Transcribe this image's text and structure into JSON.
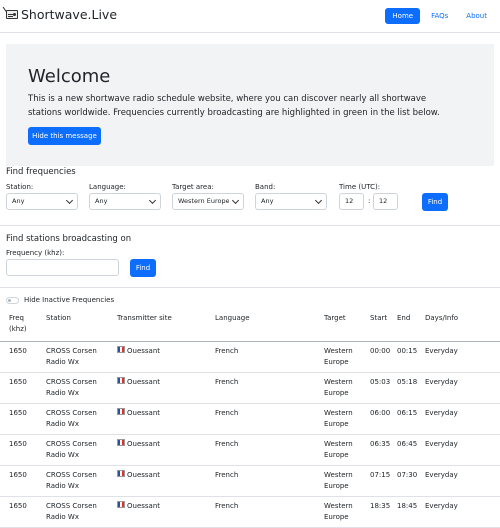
{
  "nav": {
    "brand": "Shortwave.Live",
    "brand_icon": "radio-icon",
    "links": [
      {
        "label": "Home",
        "active": true
      },
      {
        "label": "FAQs",
        "active": false
      },
      {
        "label": "About",
        "active": false
      }
    ]
  },
  "hero": {
    "title": "Welcome",
    "text": "This is a new shortwave radio schedule website, where you can discover nearly all shortwave stations worldwide. Frequencies currently broadcasting are highlighted in green in the list below.",
    "button": "Hide this message"
  },
  "find": {
    "title": "Find frequencies",
    "station_label": "Station:",
    "station_value": "Any",
    "language_label": "Language:",
    "language_value": "Any",
    "target_label": "Target area:",
    "target_value": "Western Europe",
    "band_label": "Band:",
    "band_value": "Any",
    "time_label": "Time (UTC):",
    "time_hour": "12",
    "time_sep": ":",
    "time_min": "12",
    "button": "Find"
  },
  "broadcast": {
    "title": "Find stations broadcasting on",
    "freq_label": "Frequency (khz):",
    "freq_value": "",
    "button": "Find"
  },
  "toggle_label": "Hide Inactive Frequencies",
  "table": {
    "headers": {
      "freq": "Freq (khz)",
      "station": "Station",
      "site": "Transmitter site",
      "language": "Language",
      "target": "Target",
      "start": "Start",
      "end": "End",
      "days": "Days/Info"
    },
    "rows": [
      {
        "freq": "1650",
        "station": "CROSS Corsen Radio Wx",
        "site": "Ouessant",
        "language": "French",
        "target": "Western Europe",
        "start": "00:00",
        "end": "00:15",
        "days": "Everyday"
      },
      {
        "freq": "1650",
        "station": "CROSS Corsen Radio Wx",
        "site": "Ouessant",
        "language": "French",
        "target": "Western Europe",
        "start": "05:03",
        "end": "05:18",
        "days": "Everyday"
      },
      {
        "freq": "1650",
        "station": "CROSS Corsen Radio Wx",
        "site": "Ouessant",
        "language": "French",
        "target": "Western Europe",
        "start": "06:00",
        "end": "06:15",
        "days": "Everyday"
      },
      {
        "freq": "1650",
        "station": "CROSS Corsen Radio Wx",
        "site": "Ouessant",
        "language": "French",
        "target": "Western Europe",
        "start": "06:35",
        "end": "06:45",
        "days": "Everyday"
      },
      {
        "freq": "1650",
        "station": "CROSS Corsen Radio Wx",
        "site": "Ouessant",
        "language": "French",
        "target": "Western Europe",
        "start": "07:15",
        "end": "07:30",
        "days": "Everyday"
      },
      {
        "freq": "1650",
        "station": "CROSS Corsen Radio Wx",
        "site": "Ouessant",
        "language": "French",
        "target": "Western Europe",
        "start": "18:35",
        "end": "18:45",
        "days": "Everyday"
      }
    ]
  }
}
